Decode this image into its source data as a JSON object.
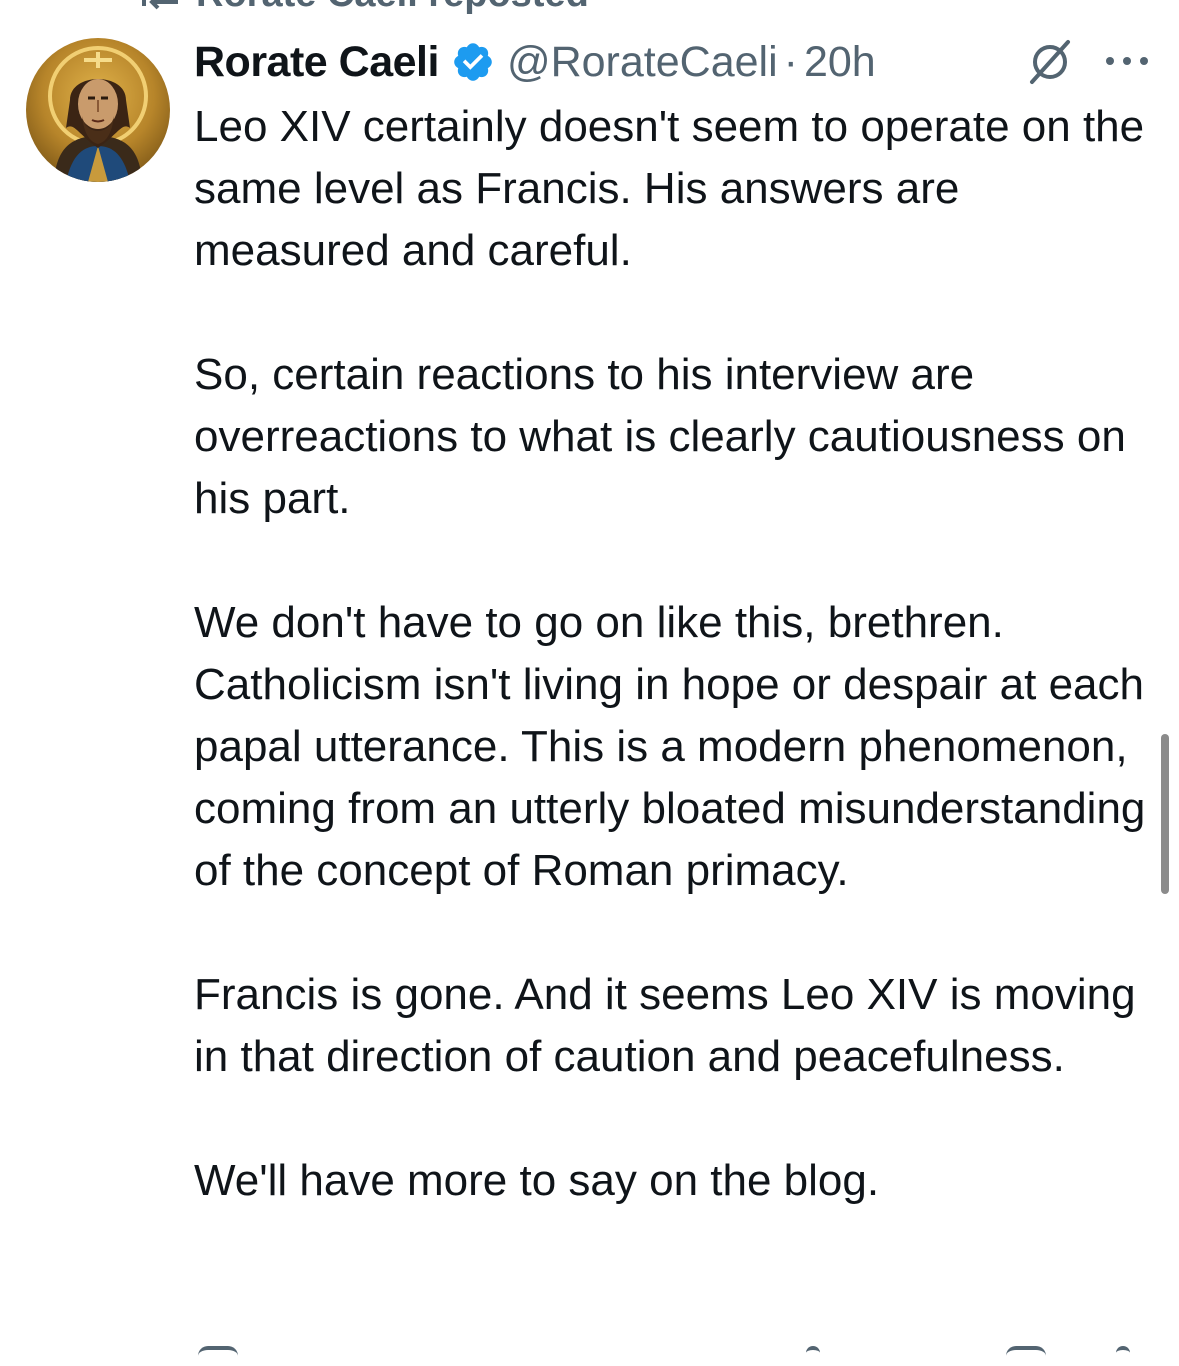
{
  "repost": {
    "icon": "repost-icon",
    "label": "Rorate Caeli reposted"
  },
  "tweet": {
    "avatar_icon": "christ-pantocrator-avatar",
    "display_name": "Rorate Caeli",
    "verified_icon": "verified-badge-icon",
    "verified_color": "#1d9bf0",
    "handle": "@RorateCaeli",
    "separator": "·",
    "timestamp": "20h",
    "grok_icon": "grok-icon",
    "more_icon": "more-icon",
    "paragraphs": [
      "Leo XIV certainly doesn't seem to operate on the same level as Francis. His answers are measured and careful.",
      "So, certain reactions to his interview are overreactions to what is clearly cautiousness on his part.",
      "We don't have to go on like this, brethren. Catholicism isn't living in hope or despair at each papal utterance. This is a modern phenomenon, coming from an utterly bloated misunderstanding of the concept of Roman primacy.",
      "Francis is gone. And it seems Leo XIV is moving in that direction of caution and peacefulness.",
      "We'll have more to say on the blog."
    ]
  },
  "colors": {
    "text_primary": "#0f1419",
    "text_secondary": "#536471",
    "verified": "#1d9bf0",
    "background": "#ffffff"
  }
}
